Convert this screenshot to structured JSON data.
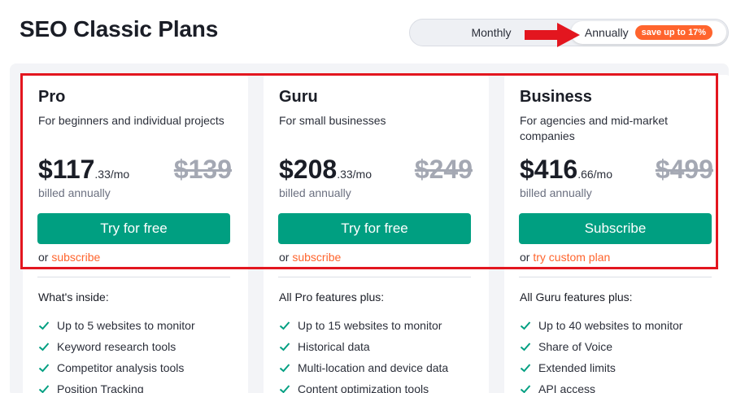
{
  "page": {
    "title": "SEO Classic Plans"
  },
  "billing_toggle": {
    "monthly_label": "Monthly",
    "annual_label": "Annually",
    "annual_badge": "save up to 17%",
    "selected": "Annually"
  },
  "colors": {
    "accent_green": "#009f81",
    "accent_orange": "#ff642d",
    "highlight_red": "#e3161f"
  },
  "plans": [
    {
      "name": "Pro",
      "description": "For beginners and individual projects",
      "price_main": "$117",
      "price_cents": ".33/mo",
      "price_old": "$139",
      "billed": "billed annually",
      "cta_label": "Try for free",
      "alt_prefix": "or",
      "alt_link": "subscribe",
      "features_heading": "What's inside:",
      "features": [
        "Up to 5 websites to monitor",
        "Keyword research tools",
        "Competitor analysis tools",
        "Position Tracking"
      ]
    },
    {
      "name": "Guru",
      "description": "For small businesses",
      "price_main": "$208",
      "price_cents": ".33/mo",
      "price_old": "$249",
      "billed": "billed annually",
      "cta_label": "Try for free",
      "alt_prefix": "or",
      "alt_link": "subscribe",
      "features_heading": "All Pro features plus:",
      "features": [
        "Up to 15 websites to monitor",
        "Historical data",
        "Multi-location and device data",
        "Content optimization tools"
      ]
    },
    {
      "name": "Business",
      "description": "For agencies and mid-market companies",
      "price_main": "$416",
      "price_cents": ".66/mo",
      "price_old": "$499",
      "billed": "billed annually",
      "cta_label": "Subscribe",
      "alt_prefix": "or",
      "alt_link": "try custom plan",
      "features_heading": "All Guru features plus:",
      "features": [
        "Up to 40 websites to monitor",
        "Share of Voice",
        "Extended limits",
        "API access"
      ]
    }
  ]
}
